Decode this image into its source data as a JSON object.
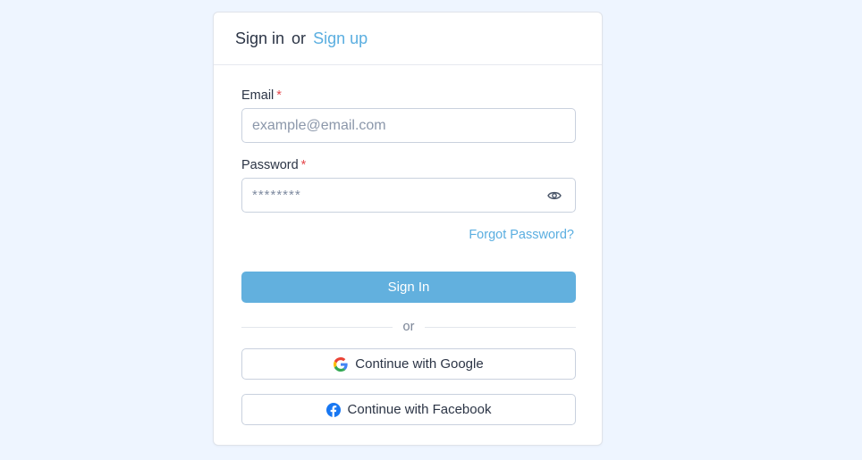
{
  "header": {
    "signin_label": "Sign in",
    "or_label": "or",
    "signup_label": "Sign up"
  },
  "email": {
    "label": "Email",
    "required_mark": "*",
    "placeholder": "example@email.com"
  },
  "password": {
    "label": "Password",
    "required_mark": "*",
    "value_mask": "********"
  },
  "forgot_password_label": "Forgot Password?",
  "signin_button_label": "Sign In",
  "divider_label": "or",
  "google_button_label": "Continue with Google",
  "facebook_button_label": "Continue with Facebook",
  "colors": {
    "background": "#eef5ff",
    "accent": "#5aaee0",
    "primary_button": "#62b0de",
    "required": "#e5484d",
    "facebook": "#1877f2"
  },
  "icons": {
    "password_toggle": "eye-icon",
    "google": "google-logo-icon",
    "facebook": "facebook-logo-icon"
  }
}
